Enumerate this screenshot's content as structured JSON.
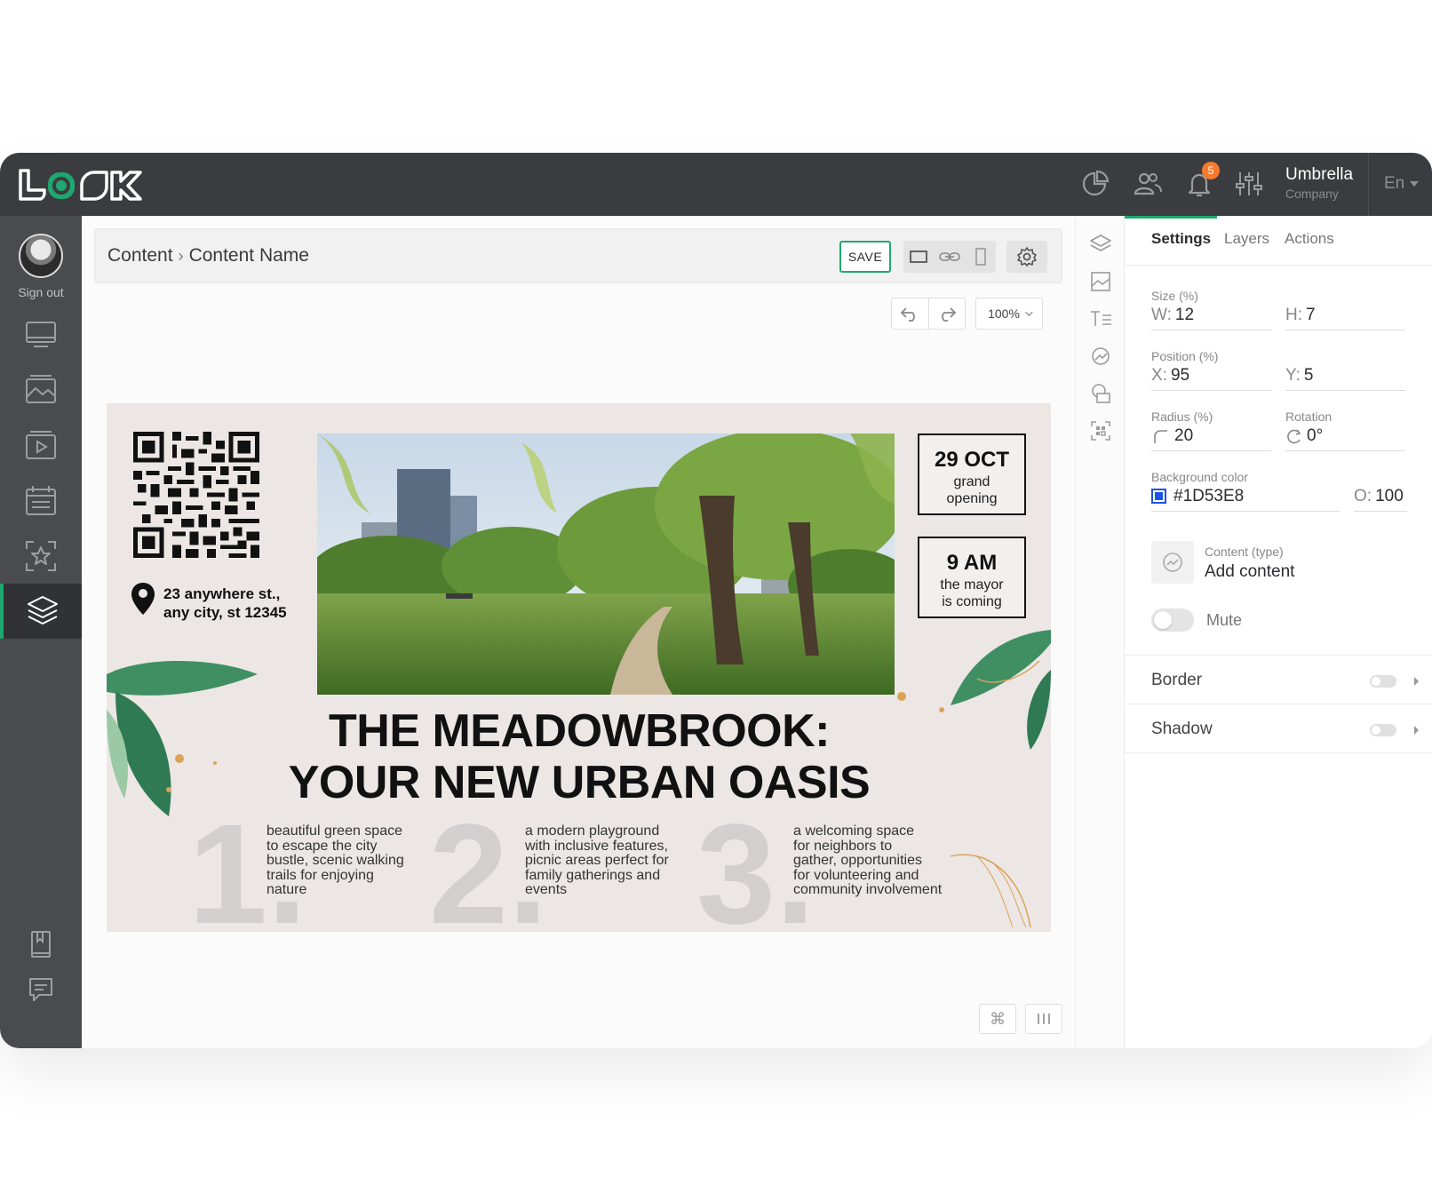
{
  "header": {
    "logo_text": "LOOK",
    "notifications_count": "5",
    "org_name": "Umbrella",
    "org_sub": "Company",
    "language": "En",
    "icons": [
      "analytics-icon",
      "users-icon",
      "bell-icon",
      "sliders-icon"
    ]
  },
  "sidebar": {
    "sign_out": "Sign out",
    "items": [
      "screens-icon",
      "media-icon",
      "playlist-icon",
      "schedule-icon",
      "templates-icon",
      "layers-icon",
      "guide-icon",
      "chat-icon"
    ],
    "active_item": "layers-icon"
  },
  "toolbar": {
    "breadcrumb_root": "Content",
    "breadcrumb_separator": "›",
    "breadcrumb_page": "Content Name",
    "save_label": "SAVE",
    "zoom": "100%"
  },
  "poster": {
    "address_line1": "23 anywhere st.,",
    "address_line2": "any city, st 12345",
    "date_big": "29 OCT",
    "date_line1": "grand",
    "date_line2": "opening",
    "time_big": "9 AM",
    "time_line1": "the mayor",
    "time_line2": "is coming",
    "headline_line1": "THE MEADOWBROOK:",
    "headline_line2": "YOUR NEW URBAN OASIS",
    "features": [
      {
        "num": "1.",
        "lines": [
          "beautiful green space",
          "to escape the city",
          "bustle, scenic walking",
          "trails for enjoying",
          "nature"
        ]
      },
      {
        "num": "2.",
        "lines": [
          "a modern playground",
          "with inclusive features,",
          "picnic areas perfect for",
          "family gatherings and",
          "events"
        ]
      },
      {
        "num": "3.",
        "lines": [
          "a welcoming space",
          "for neighbors to",
          "gather, opportunities",
          "for volunteering and",
          "community involvement"
        ]
      }
    ]
  },
  "panel": {
    "tabs": [
      "Settings",
      "Layers",
      "Actions"
    ],
    "active_tab": "Settings",
    "size_label": "Size (%)",
    "w_prefix": "W:",
    "w_value": "12",
    "h_prefix": "H:",
    "h_value": "7",
    "position_label": "Position (%)",
    "x_prefix": "X:",
    "x_value": "95",
    "y_prefix": "Y:",
    "y_value": "5",
    "radius_label": "Radius (%)",
    "radius_value": "20",
    "rotation_label": "Rotation",
    "rotation_value": "0°",
    "bg_label": "Background color",
    "bg_value": "#1D53E8",
    "opacity_prefix": "O:",
    "opacity_value": "100",
    "content_type_label": "Content (type)",
    "content_type_value": "Add content",
    "mute_label": "Mute",
    "border_label": "Border",
    "shadow_label": "Shadow"
  },
  "colors": {
    "accent": "#1ea870",
    "topbar": "#3b3c3f",
    "sidebar": "#4a4b4f",
    "badge": "#f47a2d",
    "selected_bg": "#1D53E8"
  }
}
